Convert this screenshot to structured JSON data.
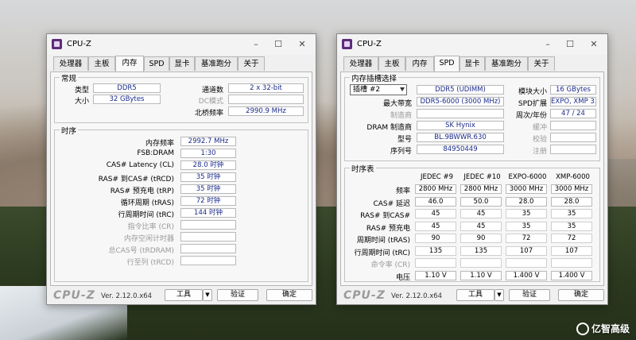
{
  "left": {
    "title": "CPU-Z",
    "tabs": [
      "处理器",
      "主板",
      "内存",
      "SPD",
      "显卡",
      "基准跑分",
      "关于"
    ],
    "general": {
      "legend": "常规",
      "type_label": "类型",
      "type_value": "DDR5",
      "size_label": "大小",
      "size_value": "32 GBytes",
      "channels_label": "通道数",
      "channels_value": "2 x 32-bit",
      "dc_label": "DC模式",
      "dc_value": "",
      "nb_label": "北桥频率",
      "nb_value": "2990.9 MHz"
    },
    "timings": {
      "legend": "时序",
      "rows": [
        {
          "label": "内存频率",
          "value": "2992.7 MHz",
          "dim": false
        },
        {
          "label": "FSB:DRAM",
          "value": "1:30",
          "dim": false
        },
        {
          "label": "CAS# Latency (CL)",
          "value": "28.0 时钟",
          "dim": false
        },
        {
          "label": "RAS# 到CAS# (tRCD)",
          "value": "35 时钟",
          "dim": false
        },
        {
          "label": "RAS# 预充电 (tRP)",
          "value": "35 时钟",
          "dim": false
        },
        {
          "label": "循环周期 (tRAS)",
          "value": "72 时钟",
          "dim": false
        },
        {
          "label": "行周期时间 (tRC)",
          "value": "144 时钟",
          "dim": false
        },
        {
          "label": "指令比率 (CR)",
          "value": "",
          "dim": true
        },
        {
          "label": "内存空闲计时器",
          "value": "",
          "dim": true
        },
        {
          "label": "总CAS号 (tRDRAM)",
          "value": "",
          "dim": true
        },
        {
          "label": "行至列 (tRCD)",
          "value": "",
          "dim": true
        }
      ]
    },
    "footer": {
      "logo": "CPU-Z",
      "version": "Ver. 2.12.0.x64",
      "tools": "工具",
      "validate": "验证",
      "ok": "确定"
    }
  },
  "right": {
    "title": "CPU-Z",
    "tabs": [
      "处理器",
      "主板",
      "内存",
      "SPD",
      "显卡",
      "基准跑分",
      "关于"
    ],
    "slot": {
      "legend": "内存插槽选择",
      "slot_value": "插槽 #2",
      "module_type": "DDR5 (UDIMM)",
      "size_label": "模块大小",
      "size_value": "16 GBytes",
      "bw_label": "最大带宽",
      "bw_value": "DDR5-6000 (3000 MHz)",
      "spd_ext_label": "SPD扩展",
      "spd_ext_value": "EXPO, XMP 3.0",
      "mfr_label": "制造商",
      "mfr_value": "",
      "week_label": "周次/年份",
      "week_value": "47 / 24",
      "dram_label": "DRAM 制造商",
      "dram_value": "SK Hynix",
      "buffer_label": "缓冲",
      "buffer_value": "",
      "part_label": "型号",
      "part_value": "BL.9BWWR.630",
      "check_label": "校验",
      "check_value": "",
      "serial_label": "序列号",
      "serial_value": "84950449",
      "reg_label": "注册",
      "reg_value": ""
    },
    "timing_table": {
      "legend": "时序表",
      "headers": [
        "JEDEC #9",
        "JEDEC #10",
        "EXPO-6000",
        "XMP-6000"
      ],
      "rows": [
        {
          "label": "频率",
          "values": [
            "2800 MHz",
            "2800 MHz",
            "3000 MHz",
            "3000 MHz"
          ],
          "dim": false,
          "boxed": true
        },
        {
          "label": "CAS# 延迟",
          "values": [
            "46.0",
            "50.0",
            "28.0",
            "28.0"
          ],
          "dim": false,
          "boxed": true
        },
        {
          "label": "RAS# 到CAS#",
          "values": [
            "45",
            "45",
            "35",
            "35"
          ],
          "dim": false,
          "boxed": false
        },
        {
          "label": "RAS# 预充电",
          "values": [
            "45",
            "45",
            "35",
            "35"
          ],
          "dim": false,
          "boxed": false
        },
        {
          "label": "周期时间 (tRAS)",
          "values": [
            "90",
            "90",
            "72",
            "72"
          ],
          "dim": false,
          "boxed": false
        },
        {
          "label": "行周期时间 (tRC)",
          "values": [
            "135",
            "135",
            "107",
            "107"
          ],
          "dim": false,
          "boxed": false
        },
        {
          "label": "命令率 (CR)",
          "values": [
            "",
            "",
            "",
            ""
          ],
          "dim": true,
          "boxed": false
        },
        {
          "label": "电压",
          "values": [
            "1.10 V",
            "1.10 V",
            "1.400 V",
            "1.400 V"
          ],
          "dim": false,
          "boxed": true
        }
      ]
    },
    "footer": {
      "logo": "CPU-Z",
      "version": "Ver. 2.12.0.x64",
      "tools": "工具",
      "validate": "验证",
      "ok": "确定"
    }
  },
  "watermark": "亿智高级"
}
